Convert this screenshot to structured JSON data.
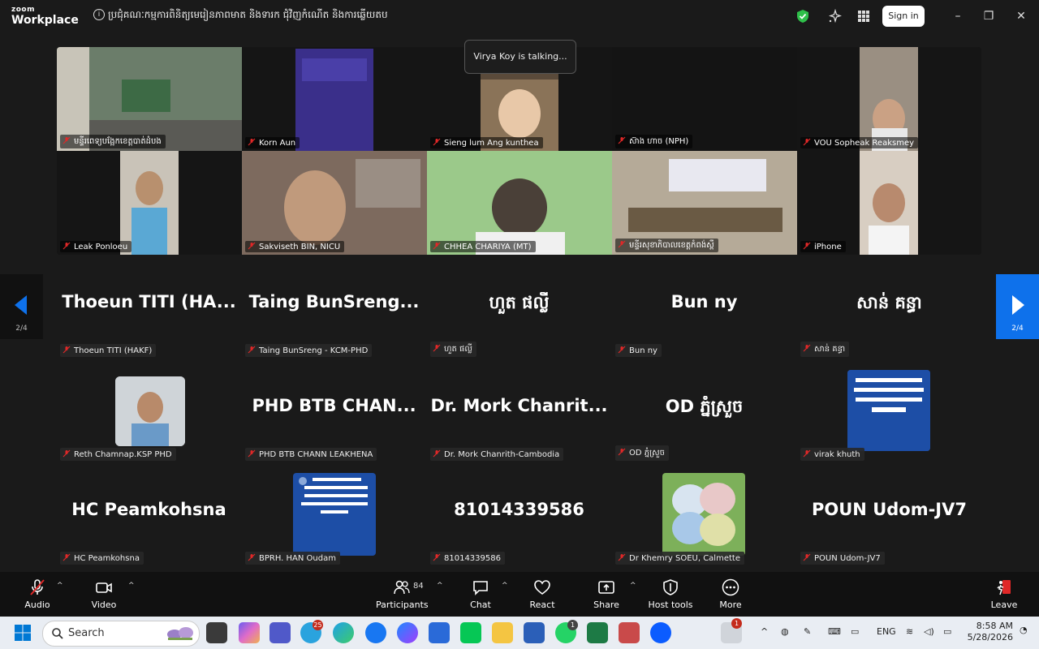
{
  "app": {
    "brand_top": "zoom",
    "brand_bottom": "Workplace"
  },
  "meeting": {
    "title": "ប្រជុំគណៈកម្មការពិនិត្យមេរៀនភាពមាត និងទារក ជុំវិញកំណើត និងការឆ្លើយតប"
  },
  "header": {
    "signin_label": "Sign in"
  },
  "talking_indicator": "Virya Koy is talking...",
  "video_tiles": [
    {
      "label": "មន្ទីរពេទ្យបង្អែកខេត្តបាត់ដំបង",
      "bg": "#6b7d6a"
    },
    {
      "label": "Korn Aun",
      "bg": "#3a2f8a"
    },
    {
      "label": "Sieng lum Ang kunthea",
      "bg": "#8a7358"
    },
    {
      "label": "ស៊ាង ហាច (NPH)",
      "bg": "#141414"
    },
    {
      "label": "VOU Sopheak Reaksmey",
      "bg": "#9a8f82"
    },
    {
      "label": "Leak Ponloeu",
      "bg": "#c9c3b8"
    },
    {
      "label": "Sakviseth BIN, NICU",
      "bg": "#7d6a5e"
    },
    {
      "label": "CHHEA CHARIYA (MT)",
      "bg": "#9bc98a"
    },
    {
      "label": "មន្ទីរសុខាភិបាលខេត្តកំពង់ស្ពឺ",
      "bg": "#b5aa98"
    },
    {
      "label": "iPhone",
      "bg": "#d8cec2"
    }
  ],
  "participant_tiles": [
    {
      "display": "Thoeun TITI (HA...",
      "label": "Thoeun TITI (HAKF)"
    },
    {
      "display": "Taing BunSreng...",
      "label": "Taing BunSreng - KCM-PHD"
    },
    {
      "display": "ហួត ផល្លី",
      "label": "ហួត ផល្លី"
    },
    {
      "display": "Bun ny",
      "label": "Bun ny"
    },
    {
      "display": "សាន់ គន្ធា",
      "label": "សាន់ គន្ធា"
    },
    {
      "display": "",
      "label": "Reth Chamnap.KSP PHD"
    },
    {
      "display": "PHD BTB CHAN...",
      "label": "PHD BTB CHANN LEAKHENA"
    },
    {
      "display": "Dr. Mork Chanrit...",
      "label": "Dr. Mork Chanrith-Cambodia"
    },
    {
      "display": "OD ភ្នំស្រួច",
      "label": "OD ភ្នំស្រួច"
    },
    {
      "display": "",
      "label": "virak khuth"
    },
    {
      "display": "HC Peamkohsna",
      "label": "HC Peamkohsna"
    },
    {
      "display": "",
      "label": "BPRH. HAN Oudam"
    },
    {
      "display": "81014339586",
      "label": "81014339586"
    },
    {
      "display": "",
      "label": "Dr Khemry SOEU, Calmette"
    },
    {
      "display": "POUN Udom-JV7",
      "label": "POUN Udom-JV7"
    }
  ],
  "pager": {
    "left": "2/4",
    "right": "2/4"
  },
  "toolbar": {
    "audio": "Audio",
    "video": "Video",
    "participants": "Participants",
    "participants_count": "84",
    "chat": "Chat",
    "react": "React",
    "share": "Share",
    "host_tools": "Host tools",
    "more": "More",
    "leave": "Leave"
  },
  "taskbar": {
    "search_placeholder": "Search",
    "telegram_badge": "25",
    "whatsapp_badge": "1",
    "tray_badge": "1",
    "lang": "ENG",
    "time": "8:58 AM",
    "date": "5/28/2026"
  },
  "colors": {
    "accent": "#0e71eb",
    "leave": "#e02828",
    "shield": "#2fbf4a"
  }
}
